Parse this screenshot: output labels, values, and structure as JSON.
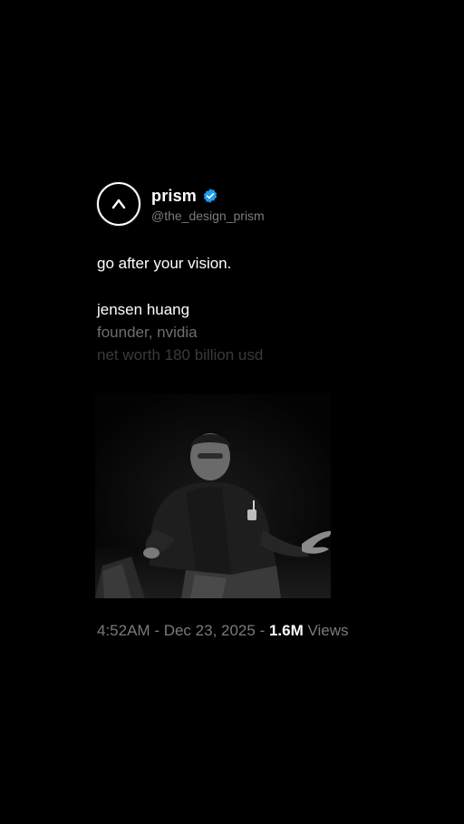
{
  "profile": {
    "name": "prism",
    "handle": "@the_design_prism",
    "avatar_glyph": "^",
    "verified_icon": "verified-badge-icon",
    "verified_color": "#1d9bf0"
  },
  "post": {
    "line1": "go after your vision.",
    "line2": "jensen huang",
    "line3": "founder, nvidia",
    "line4": "net worth 180 billion usd"
  },
  "meta": {
    "time": "4:52AM",
    "separator": " - ",
    "date": "Dec 23, 2025",
    "views_count": "1.6M",
    "views_label": "Views"
  },
  "colors": {
    "background": "#000000",
    "text_primary": "#ffffff",
    "text_secondary": "#7a7a7a"
  }
}
